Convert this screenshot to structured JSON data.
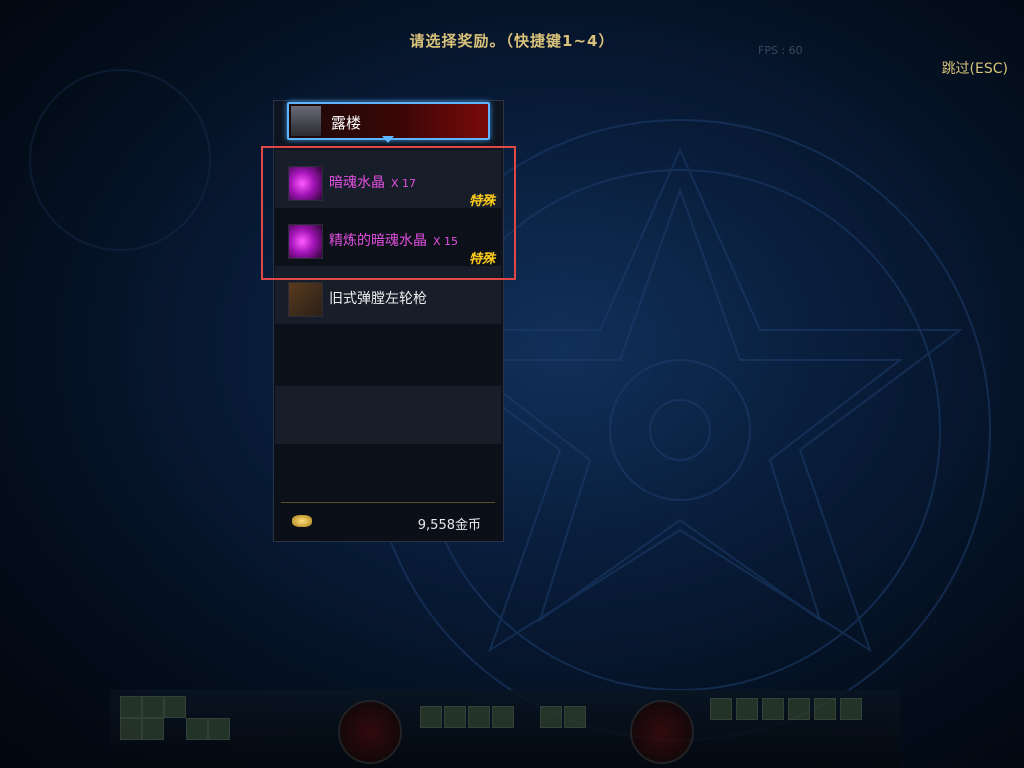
{
  "header": {
    "title": "请选择奖励。（快捷键1~4）",
    "skip_label": "跳过(ESC)",
    "fps_text": "FPS : 60"
  },
  "character": {
    "name": "露楼"
  },
  "rewards": [
    {
      "name": "暗魂水晶",
      "qty": "X 17",
      "rarity": "特殊",
      "icon": "purple-crystal-icon",
      "color": "#e24fe0"
    },
    {
      "name": "精炼的暗魂水晶",
      "qty": "X 15",
      "rarity": "特殊",
      "icon": "refined-purple-crystal-icon",
      "color": "#e24fe0"
    },
    {
      "name": "旧式弹膛左轮枪",
      "qty": "",
      "rarity": "",
      "icon": "revolver-icon",
      "color": "#eeeeee"
    }
  ],
  "gold": {
    "amount": "9,558金币",
    "icon": "gold-coin-icon"
  },
  "colors": {
    "accent_blue": "#5fb4ff",
    "highlight_red": "#e04848",
    "rarity_gold": "#ffcc1a",
    "title_gold": "#d9c27a"
  }
}
